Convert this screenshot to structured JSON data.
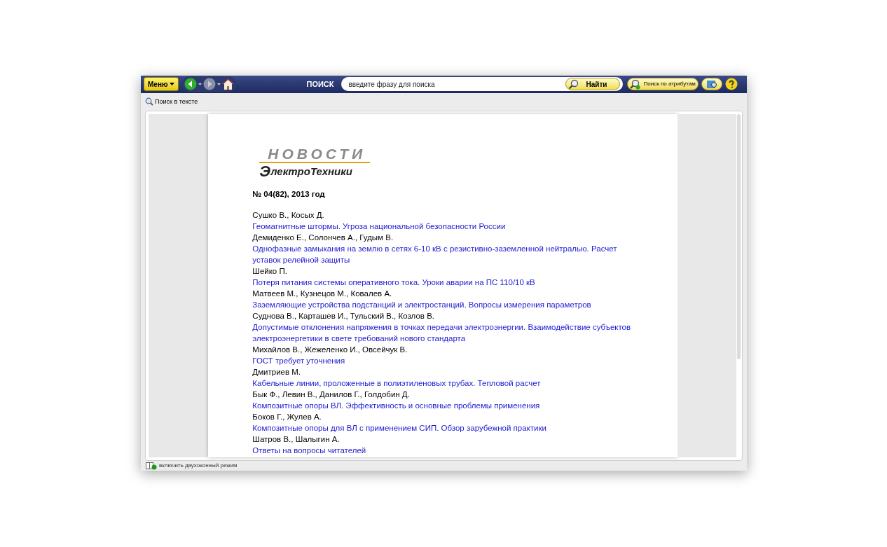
{
  "toolbar": {
    "menu_button": "Меню",
    "search_label": "ПОИСК",
    "search": {
      "placeholder": "введите фразу для поиска"
    },
    "find_button": "Найти",
    "attribute_search_button": "Поиск по атрибутам"
  },
  "subbar": {
    "text_search": "Поиск в тексте"
  },
  "document": {
    "logo": {
      "top": "НОВОСТИ",
      "bottom": "лектроТехники",
      "initial": "Э"
    },
    "issue": "№ 04(82), 2013 год",
    "entries": [
      {
        "kind": "author",
        "text": "Сушко В., Косых Д."
      },
      {
        "kind": "title",
        "text": "Геомагнитные штормы. Угроза национальной безопасности России"
      },
      {
        "kind": "author",
        "text": "Демиденко Е., Солончев А., Гудым В."
      },
      {
        "kind": "title",
        "text": "Однофазные замыкания на землю в сетях 6-10 кВ с резистивно-заземленной нейтралью. Расчет уставок релейной защиты"
      },
      {
        "kind": "author",
        "text": "Шейко П."
      },
      {
        "kind": "title",
        "text": "Потеря питания системы оперативного тока. Уроки аварии на ПС 110/10 кВ"
      },
      {
        "kind": "author",
        "text": "Матвеев М., Кузнецов М., Ковалев А."
      },
      {
        "kind": "title",
        "text": "Заземляющие устройства подстанций и электростанций. Вопросы измерения параметров"
      },
      {
        "kind": "author",
        "text": "Суднова В., Карташев И., Тульский В., Козлов В."
      },
      {
        "kind": "title",
        "text": "Допустимые отклонения напряжения в точках передачи электроэнергии. Взаимодействие субъектов электроэнергетики в свете требований нового стандарта"
      },
      {
        "kind": "author",
        "text": "Михайлов В., Жежеленко И., Овсейчук В."
      },
      {
        "kind": "title",
        "text": "ГОСТ требует уточнения"
      },
      {
        "kind": "author",
        "text": "Дмитриев М."
      },
      {
        "kind": "title",
        "text": "Кабельные линии, проложенные в полиэтиленовых трубах. Тепловой расчет"
      },
      {
        "kind": "author",
        "text": "Бык Ф., Левин В., Данилов Г., Голдобин Д."
      },
      {
        "kind": "title",
        "text": "Композитные опоры ВЛ. Эффективность и основные проблемы применения"
      },
      {
        "kind": "author",
        "text": "Боков Г., Жулев А."
      },
      {
        "kind": "title",
        "text": "Композитные опоры для ВЛ с применением СИП. Обзор зарубежной практики"
      },
      {
        "kind": "author",
        "text": "Шатров В., Шалыгин А."
      },
      {
        "kind": "title",
        "text": "Ответы на вопросы читателей"
      }
    ]
  },
  "status_bar": {
    "dual_window": "включить двухоконный режим"
  }
}
